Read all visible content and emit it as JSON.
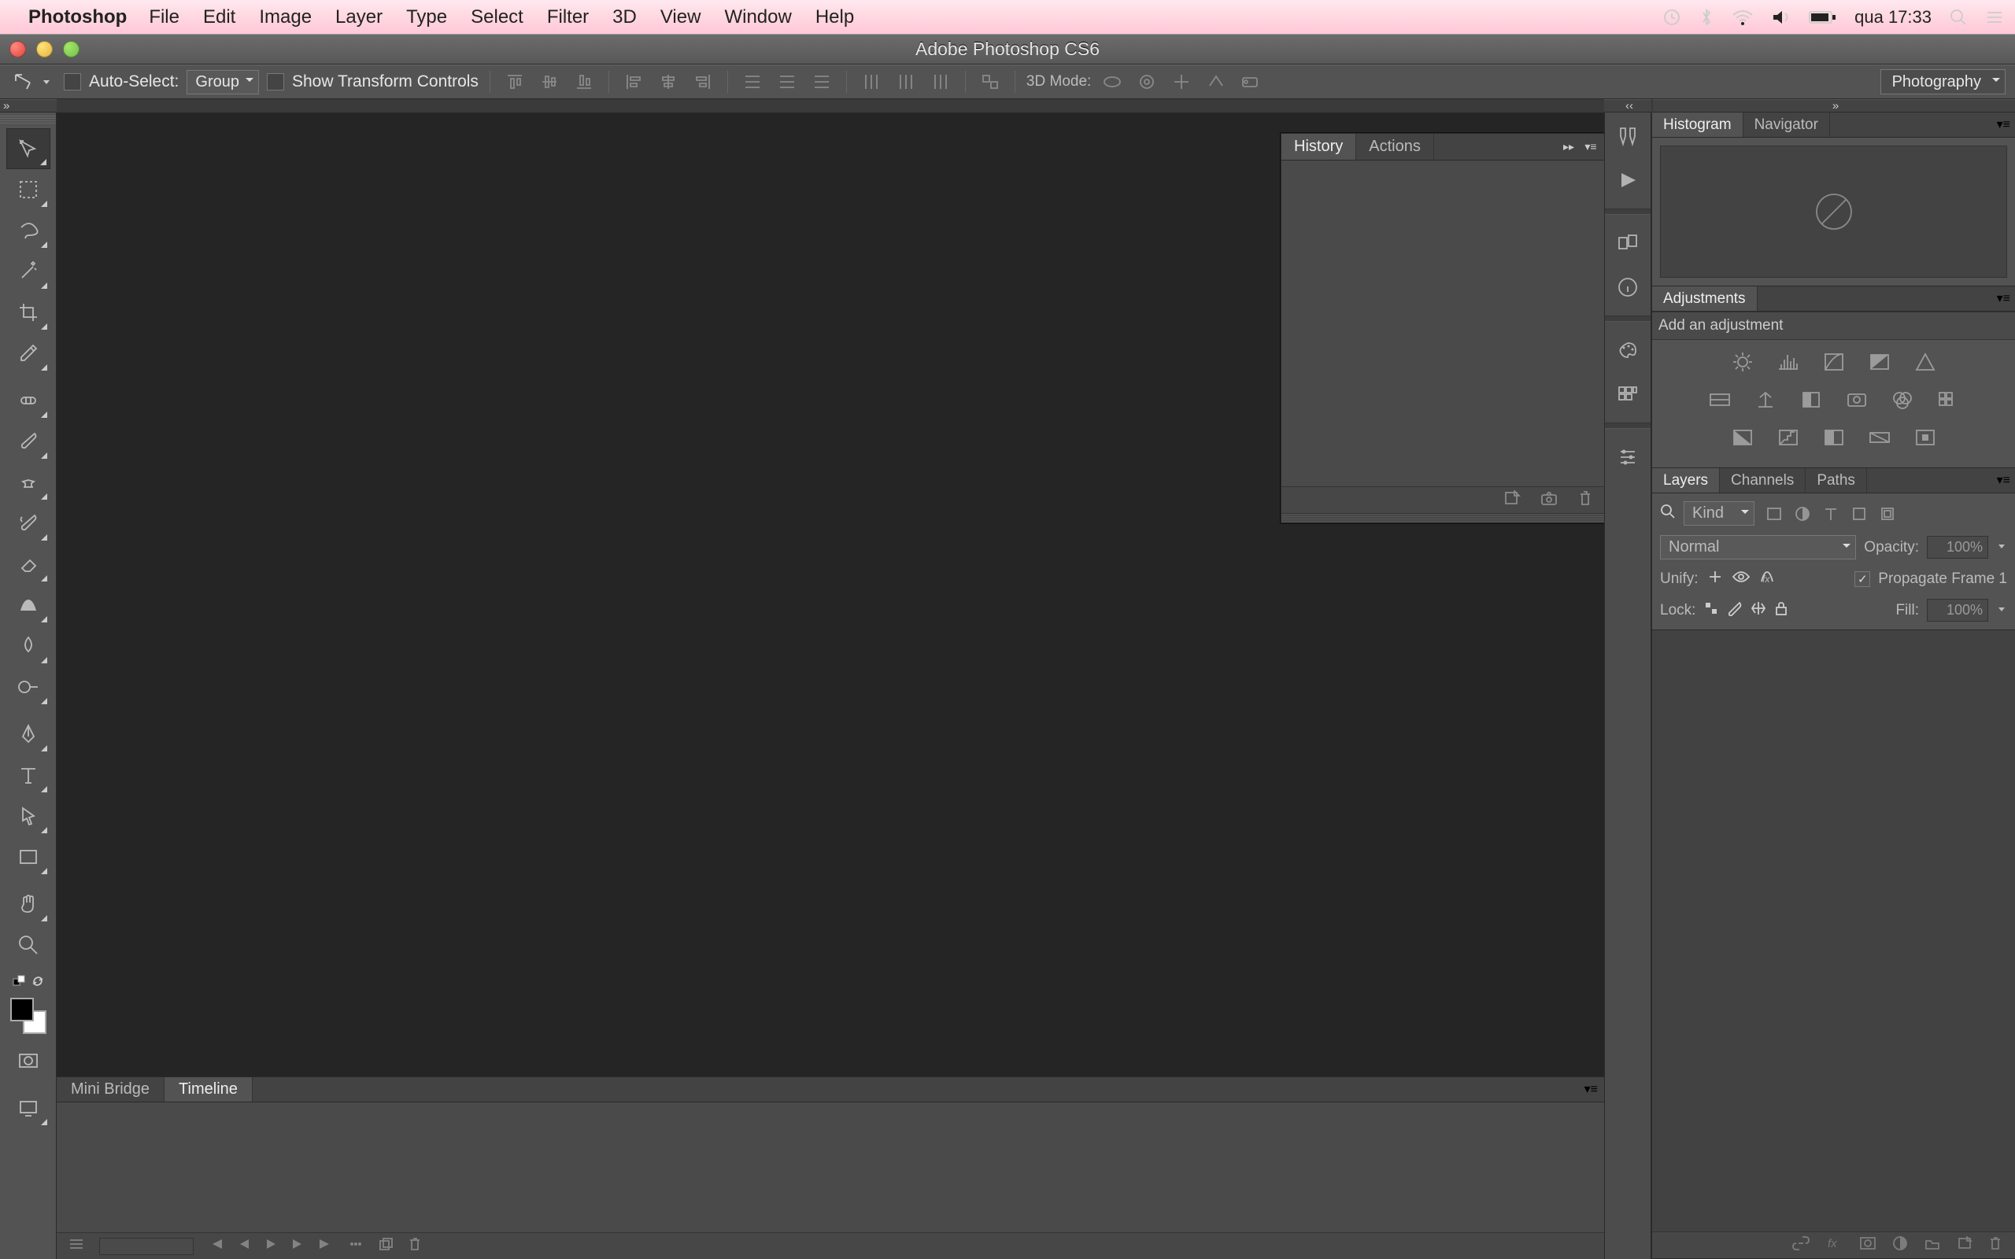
{
  "menubar": {
    "app": "Photoshop",
    "items": [
      "File",
      "Edit",
      "Image",
      "Layer",
      "Type",
      "Select",
      "Filter",
      "3D",
      "View",
      "Window",
      "Help"
    ],
    "clock": "qua 17:33"
  },
  "window": {
    "title": "Adobe Photoshop CS6"
  },
  "options_bar": {
    "auto_select_label": "Auto-Select:",
    "auto_select_value": "Group",
    "show_transform_label": "Show Transform Controls",
    "mode3d_label": "3D Mode:",
    "workspace": "Photography"
  },
  "toolbox": {
    "tools": [
      "move-tool",
      "marquee-tool",
      "lasso-tool",
      "magic-wand-tool",
      "crop-tool",
      "eyedropper-tool",
      "healing-brush-tool",
      "brush-tool",
      "clone-stamp-tool",
      "history-brush-tool",
      "eraser-tool",
      "gradient-tool",
      "blur-tool",
      "dodge-tool",
      "pen-tool",
      "type-tool",
      "path-select-tool",
      "rectangle-tool",
      "hand-tool",
      "zoom-tool"
    ]
  },
  "history_panel": {
    "tabs": [
      "History",
      "Actions"
    ]
  },
  "bottom_panel": {
    "tabs": [
      "Mini Bridge",
      "Timeline"
    ]
  },
  "right_dock": {
    "histogram": {
      "tabs": [
        "Histogram",
        "Navigator"
      ]
    },
    "adjustments": {
      "tabs": [
        "Adjustments"
      ],
      "subtitle": "Add an adjustment"
    },
    "layers": {
      "tabs": [
        "Layers",
        "Channels",
        "Paths"
      ],
      "filter_label": "Kind",
      "blend_mode": "Normal",
      "opacity_label": "Opacity:",
      "opacity_value": "100%",
      "unify_label": "Unify:",
      "propagate_label": "Propagate Frame 1",
      "lock_label": "Lock:",
      "fill_label": "Fill:",
      "fill_value": "100%"
    }
  }
}
